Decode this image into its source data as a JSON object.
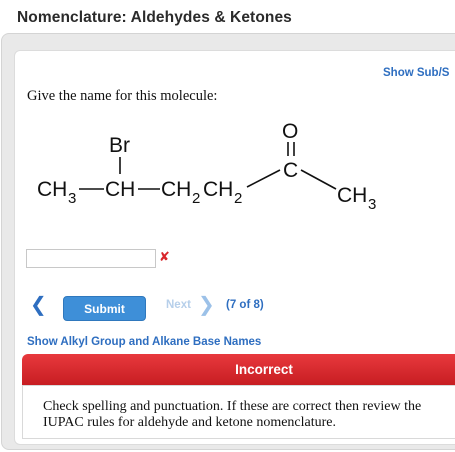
{
  "page": {
    "title": "Nomenclature: Aldehydes & Ketones"
  },
  "toolbar": {
    "show_sub": "Show Sub/S"
  },
  "question": {
    "prompt": "Give the name for this molecule:",
    "molecule": {
      "substituent": "Br",
      "oxygen": "O",
      "carbonyl_carbon": "C",
      "ch3": "CH",
      "ch": "CH",
      "ch2": "CH",
      "sub3": "3",
      "sub2": "2"
    }
  },
  "answer": {
    "value": "",
    "placeholder": ""
  },
  "nav": {
    "prev_icon": "chevron-left-icon",
    "submit_label": "Submit",
    "next_label": "Next",
    "next_icon": "chevron-right-icon",
    "progress": "(7 of 8)"
  },
  "links": {
    "alkyl": "Show Alkyl Group and Alkane Base Names"
  },
  "feedback": {
    "status": "Incorrect",
    "message": "Check spelling and punctuation. If these are correct then review the IUPAC rules for aldehyde and ketone nomenclature."
  },
  "colors": {
    "link": "#2e6ec0",
    "submit_bg": "#3e8fd8",
    "error": "#d9262b",
    "incorrect_bg": "#d62b2f"
  }
}
